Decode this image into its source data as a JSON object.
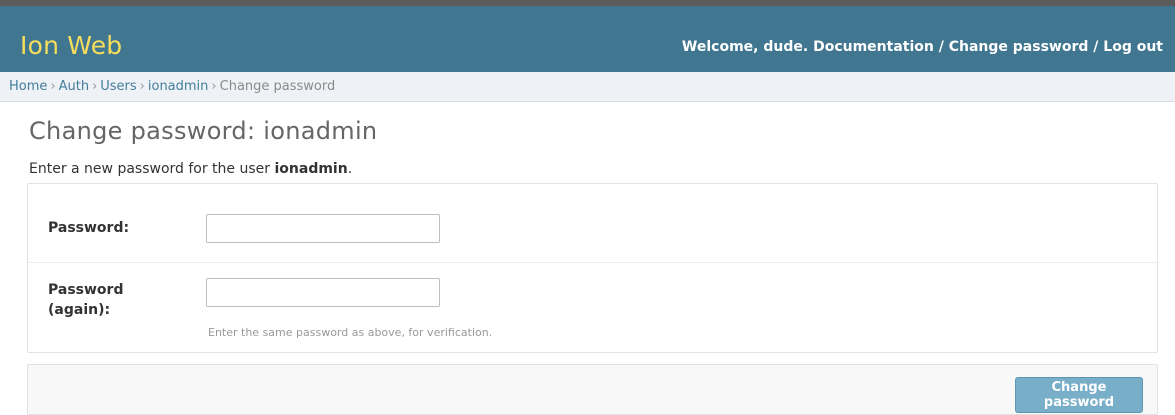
{
  "header": {
    "brand": "Ion Web",
    "welcome_prefix": "Welcome, ",
    "username": "dude",
    "welcome_suffix": ". ",
    "documentation": "Documentation",
    "sep1": " / ",
    "change_password": "Change password",
    "sep2": " / ",
    "log_out": "Log out"
  },
  "breadcrumbs": {
    "items": [
      "Home",
      "Auth",
      "Users",
      "ionadmin",
      "Change password"
    ],
    "separator": "›"
  },
  "page": {
    "title": "Change password: ionadmin",
    "intro_prefix": "Enter a new password for the user ",
    "intro_user": "ionadmin",
    "intro_suffix": "."
  },
  "form": {
    "password_label": "Password:",
    "password_value": "",
    "password2_label": "Password (again):",
    "password2_value": "",
    "help_text": "Enter the same password as above, for verification.",
    "submit_label": "Change password"
  },
  "colors": {
    "header_bg": "#417690",
    "brand": "#f5dd5d",
    "link": "#447e9b",
    "button": "#79aec8"
  }
}
